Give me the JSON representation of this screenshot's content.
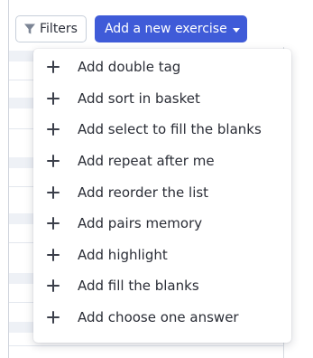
{
  "toolbar": {
    "filters_label": "Filters",
    "add_exercise_label": "Add a new exercise"
  },
  "icons": {
    "filter": "filter-funnel-icon",
    "caret": "caret-down-icon",
    "plus": "plus-icon"
  },
  "colors": {
    "primary": "#3f5bd8",
    "text": "#2a2d36"
  },
  "menu": {
    "items": [
      {
        "label": "Add double tag"
      },
      {
        "label": "Add sort in basket"
      },
      {
        "label": "Add select to fill the blanks"
      },
      {
        "label": "Add repeat after me"
      },
      {
        "label": "Add reorder the list"
      },
      {
        "label": "Add pairs memory"
      },
      {
        "label": "Add highlight"
      },
      {
        "label": "Add fill the blanks"
      },
      {
        "label": "Add choose one answer"
      }
    ]
  }
}
